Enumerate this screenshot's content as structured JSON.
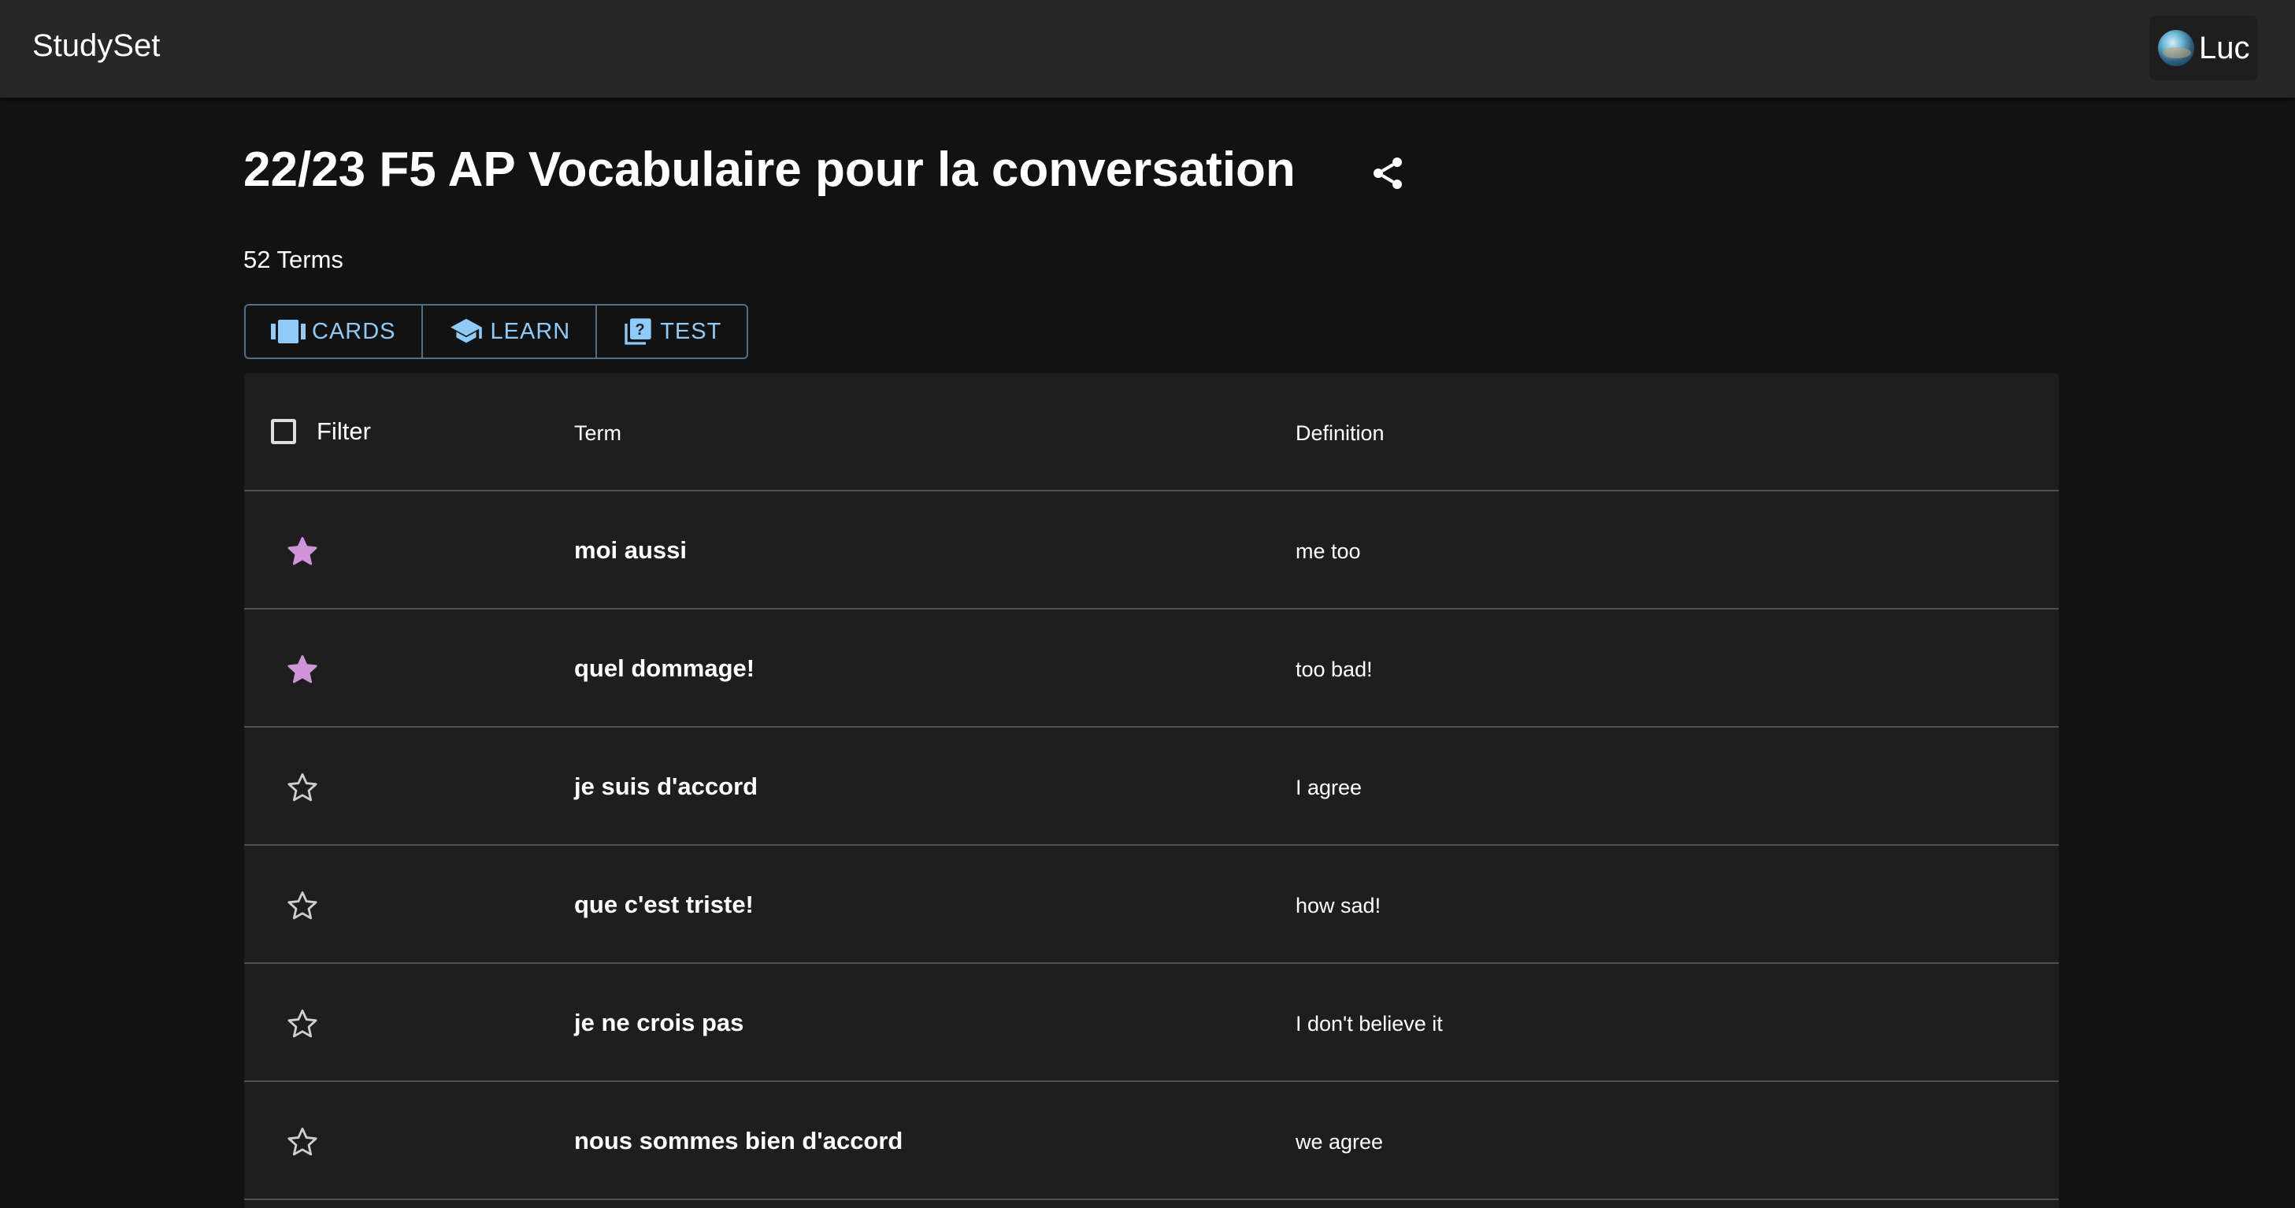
{
  "app": {
    "brand": "StudySet"
  },
  "user": {
    "name": "Luc"
  },
  "set": {
    "title": "22/23 F5 AP Vocabulaire pour la conversation",
    "term_count": "52 Terms"
  },
  "modes": [
    {
      "label": "CARDS",
      "icon": "cards-icon"
    },
    {
      "label": "LEARN",
      "icon": "graduation-cap-icon"
    },
    {
      "label": "TEST",
      "icon": "quiz-icon"
    }
  ],
  "table": {
    "filter_label": "Filter",
    "term_header": "Term",
    "definition_header": "Definition",
    "rows": [
      {
        "term": "moi aussi",
        "definition": "me too",
        "starred": true
      },
      {
        "term": "quel dommage!",
        "definition": "too bad!",
        "starred": true
      },
      {
        "term": "je suis d'accord",
        "definition": "I agree",
        "starred": false
      },
      {
        "term": "que c'est triste!",
        "definition": "how sad!",
        "starred": false
      },
      {
        "term": "je ne crois pas",
        "definition": "I don't believe it",
        "starred": false
      },
      {
        "term": "nous sommes bien d'accord",
        "definition": "we agree",
        "starred": false
      }
    ]
  },
  "colors": {
    "accent": "#90caf9",
    "star_filled": "#ce93d8",
    "background": "#121212",
    "appbar": "#272727",
    "table_bg": "#1e1e1e"
  }
}
